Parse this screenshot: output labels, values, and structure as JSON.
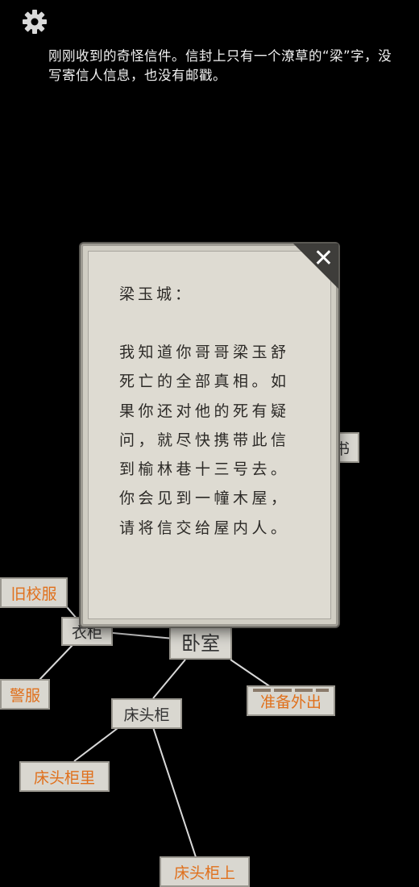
{
  "settings_icon": "gear-icon",
  "message": "刚刚收到的奇怪信件。信封上只有一个潦草的“梁”字，没写寄信人信息，也没有邮戳。",
  "letter": {
    "salutation": "梁玉城：",
    "lines": [
      "我知道你哥哥梁玉舒",
      "死亡的全部真相。如",
      "果你还对他的死有疑",
      "问，就尽快携带此信",
      "到榆林巷十三号去。",
      "你会见到一幢木屋，",
      "请将信交给屋内人。"
    ],
    "close_icon": "close-icon"
  },
  "map": {
    "nodes": {
      "bedroom": "卧室",
      "wardrobe": "衣柜",
      "old_uniform": "旧校服",
      "police_uniform": "警服",
      "nightstand": "床头柜",
      "nightstand_inside": "床头柜里",
      "go_out": "准备外出",
      "nightstand_top": "床头柜上",
      "book": "书"
    }
  }
}
